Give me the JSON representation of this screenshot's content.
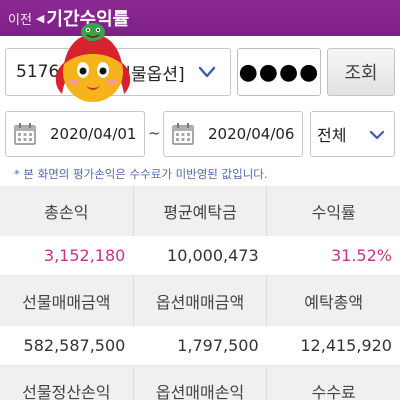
{
  "header": {
    "back_label": "이전",
    "title": "기간수익률"
  },
  "account": {
    "value": "5176-",
    "suffix": "선물옵션]"
  },
  "password": {
    "value": "●●●●"
  },
  "query_button": "조회",
  "dates": {
    "from": "2020/04/01",
    "separator": "~",
    "to": "2020/04/06"
  },
  "type_filter": {
    "value": "전체"
  },
  "notice": "* 본 화면의 평가손익은 수수료가 미반영된 값입니다.",
  "table": {
    "row1_headers": [
      "총손익",
      "평균예탁금",
      "수익률"
    ],
    "row1_values": [
      "3,152,180",
      "10,000,473",
      "31.52%"
    ],
    "row2_headers": [
      "선물매매금액",
      "옵션매매금액",
      "예탁총액"
    ],
    "row2_values": [
      "582,587,500",
      "1,797,500",
      "12,415,920"
    ],
    "row3_headers": [
      "선물정산손익",
      "옵션매매손익",
      "수수료"
    ]
  },
  "colors": {
    "header_bg": "#7e1f87",
    "accent_pink": "#c4357f",
    "notice_blue": "#5867b0"
  },
  "icons": {
    "back": "back-arrow-icon",
    "calendar": "calendar-icon",
    "dropdown": "chevron-down-icon",
    "mascot": "mascot-sticker"
  }
}
